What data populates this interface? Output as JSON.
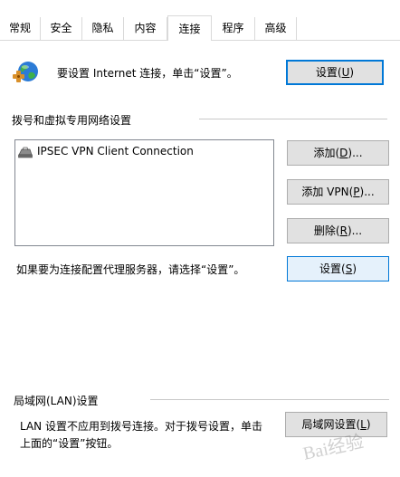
{
  "tabs": [
    {
      "label": "常规",
      "active": false
    },
    {
      "label": "安全",
      "active": false
    },
    {
      "label": "隐私",
      "active": false
    },
    {
      "label": "内容",
      "active": false
    },
    {
      "label": "连接",
      "active": true
    },
    {
      "label": "程序",
      "active": false
    },
    {
      "label": "高级",
      "active": false
    }
  ],
  "setup": {
    "text": "要设置 Internet 连接，单击“设置”。",
    "button_pre": "设置(",
    "button_key": "U",
    "button_post": ")"
  },
  "dialup": {
    "group_title": "拨号和虚拟专用网络设置",
    "connections": [
      "IPSEC VPN Client Connection"
    ],
    "add_pre": "添加(",
    "add_key": "D",
    "add_post": ")...",
    "add_vpn_pre": "添加 VPN(",
    "add_vpn_key": "P",
    "add_vpn_post": ")...",
    "remove_pre": "删除(",
    "remove_key": "R",
    "remove_post": ")...",
    "proxy_text": "如果要为连接配置代理服务器，请选择“设置”。",
    "settings_pre": "设置(",
    "settings_key": "S",
    "settings_post": ")"
  },
  "lan": {
    "group_title": "局域网(LAN)设置",
    "text_line1": "LAN 设置不应用到拨号连接。对于拨号设置，单击",
    "text_line2": "上面的“设置”按钮。",
    "button_pre": "局域网设置(",
    "button_key": "L",
    "button_post": ")"
  },
  "icons": {
    "globe": "internet-globe-icon",
    "connection": "vpn-connection-icon"
  },
  "colors": {
    "accent": "#0078d7",
    "button_bg": "#e1e1e1",
    "focus_bg": "#e5f1fb"
  },
  "watermark": "Bai经验"
}
